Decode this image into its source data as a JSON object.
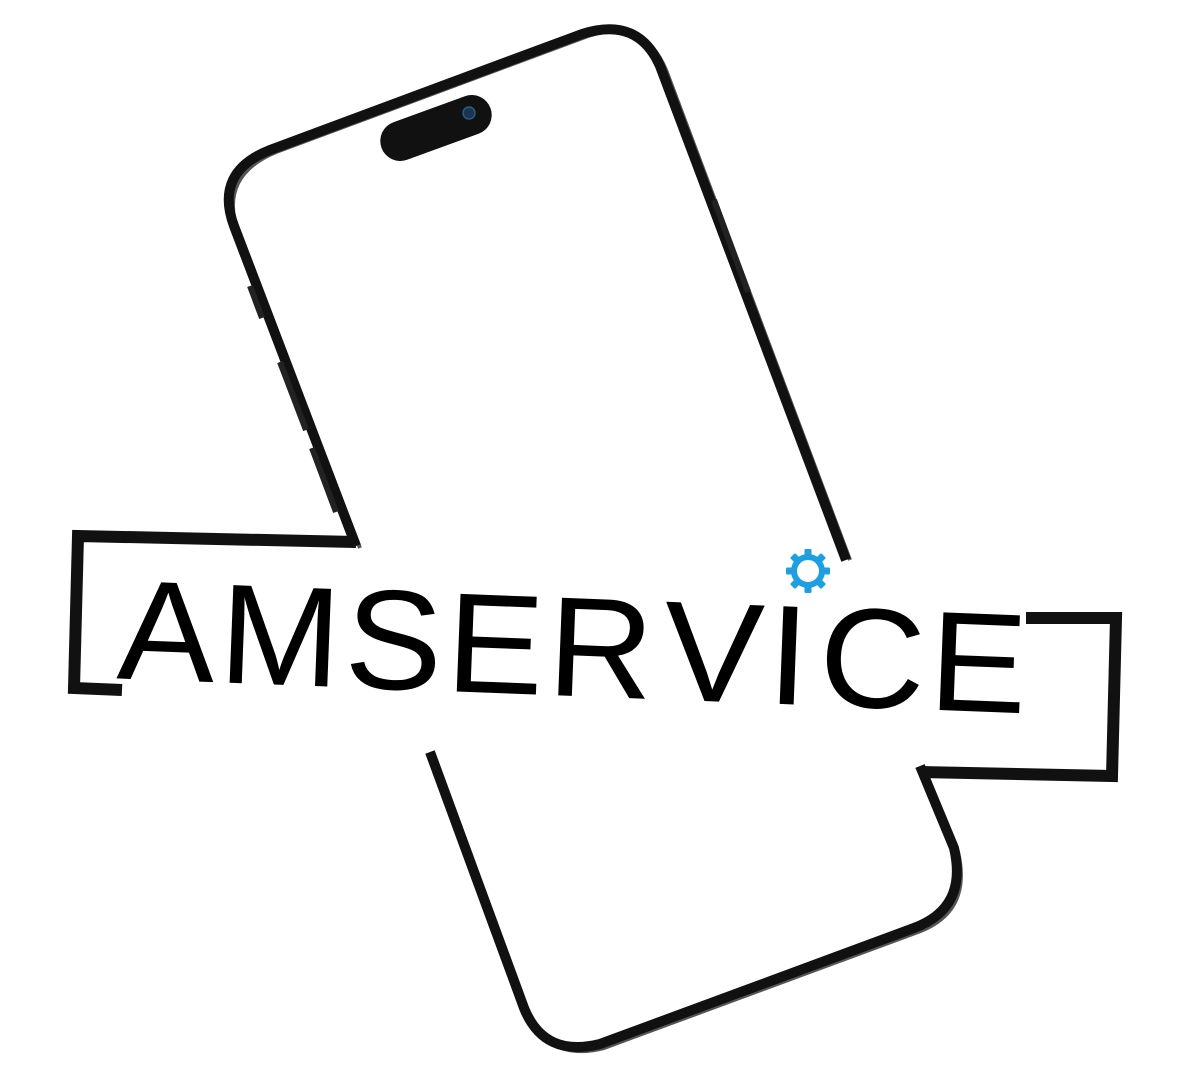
{
  "logo": {
    "text_before_gear": "AMSER",
    "text_gear_letters": "VI",
    "text_after_gear": "CE",
    "full_text": "AMSERVICE",
    "icons": [
      "smartphone-outline-icon",
      "gear-icon",
      "camera-icon"
    ],
    "colors": {
      "outline": "#111111",
      "text": "#000000",
      "gear": "#1E9FE0",
      "background": "#FFFFFF"
    }
  }
}
